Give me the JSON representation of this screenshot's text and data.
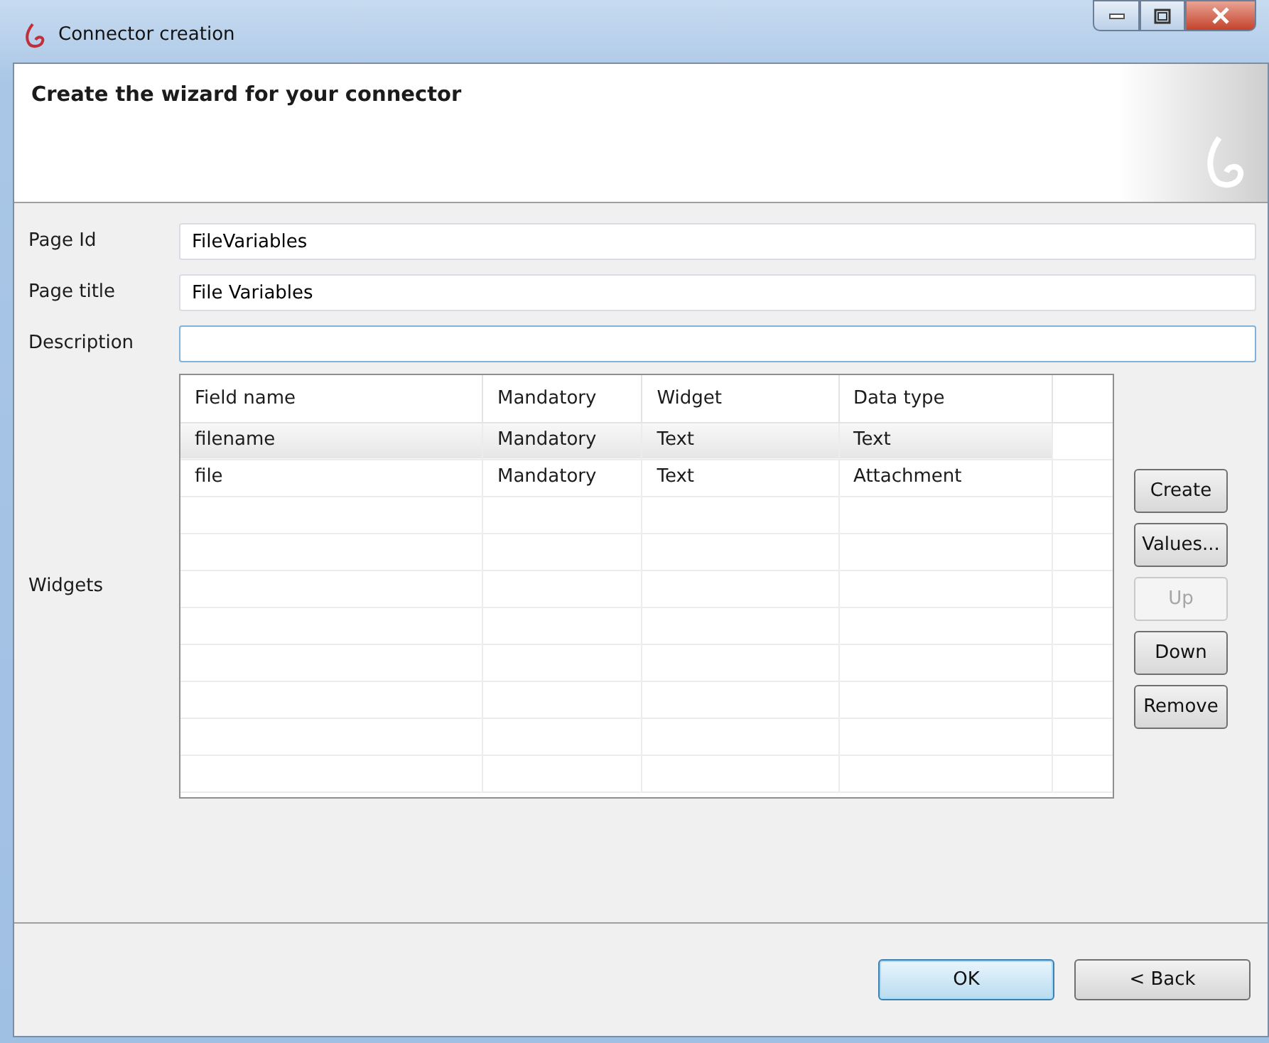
{
  "window": {
    "title": "Connector creation"
  },
  "header": {
    "title": "Create the wizard for your connector"
  },
  "fields": [
    {
      "label": "Page Id",
      "value": "FileVariables"
    },
    {
      "label": "Page title",
      "value": "File Variables"
    },
    {
      "label": "Description",
      "focused": true
    }
  ],
  "widgets": {
    "label": "Widgets",
    "table": {
      "columns": [
        "Field name",
        "Mandatory",
        "Widget",
        "Data type"
      ],
      "rows": [
        {
          "cells": [
            "filename",
            "Mandatory",
            "Text",
            "Text"
          ],
          "selected": true
        },
        {
          "cells": [
            "file",
            "Mandatory",
            "Text",
            "Attachment"
          ],
          "selected": false
        }
      ]
    },
    "buttons": [
      {
        "label": "Create",
        "disabled": false
      },
      {
        "label": "Values...",
        "disabled": false
      },
      {
        "label": "Up",
        "disabled": true
      },
      {
        "label": "Down",
        "disabled": false
      },
      {
        "label": "Remove",
        "disabled": false
      }
    ]
  },
  "footer_buttons": [
    {
      "label": "OK",
      "default": true
    },
    {
      "label": "< Back",
      "default": false
    }
  ]
}
